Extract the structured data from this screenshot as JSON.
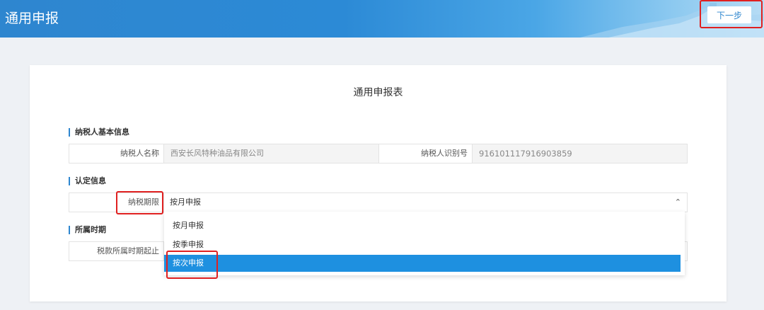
{
  "header": {
    "title": "通用申报",
    "next_label": "下一步"
  },
  "form": {
    "title": "通用申报表",
    "sections": {
      "basic": "纳税人基本信息",
      "auth": "认定信息",
      "period": "所属时期"
    },
    "taxpayer_name_label": "纳税人名称",
    "taxpayer_name_value": "西安长风特种油品有限公司",
    "taxpayer_id_label": "纳税人识别号",
    "taxpayer_id_value": "916101117916903859",
    "tax_period_label": "纳税期限",
    "tax_period_value": "按月申报",
    "period_start_label": "税款所属时期起止"
  },
  "dropdown": {
    "options": [
      "按月申报",
      "按季申报",
      "按次申报"
    ],
    "selected_index": 2
  },
  "colors": {
    "accent": "#2e86cf",
    "selected": "#1e90e0",
    "highlight": "#e02020"
  }
}
